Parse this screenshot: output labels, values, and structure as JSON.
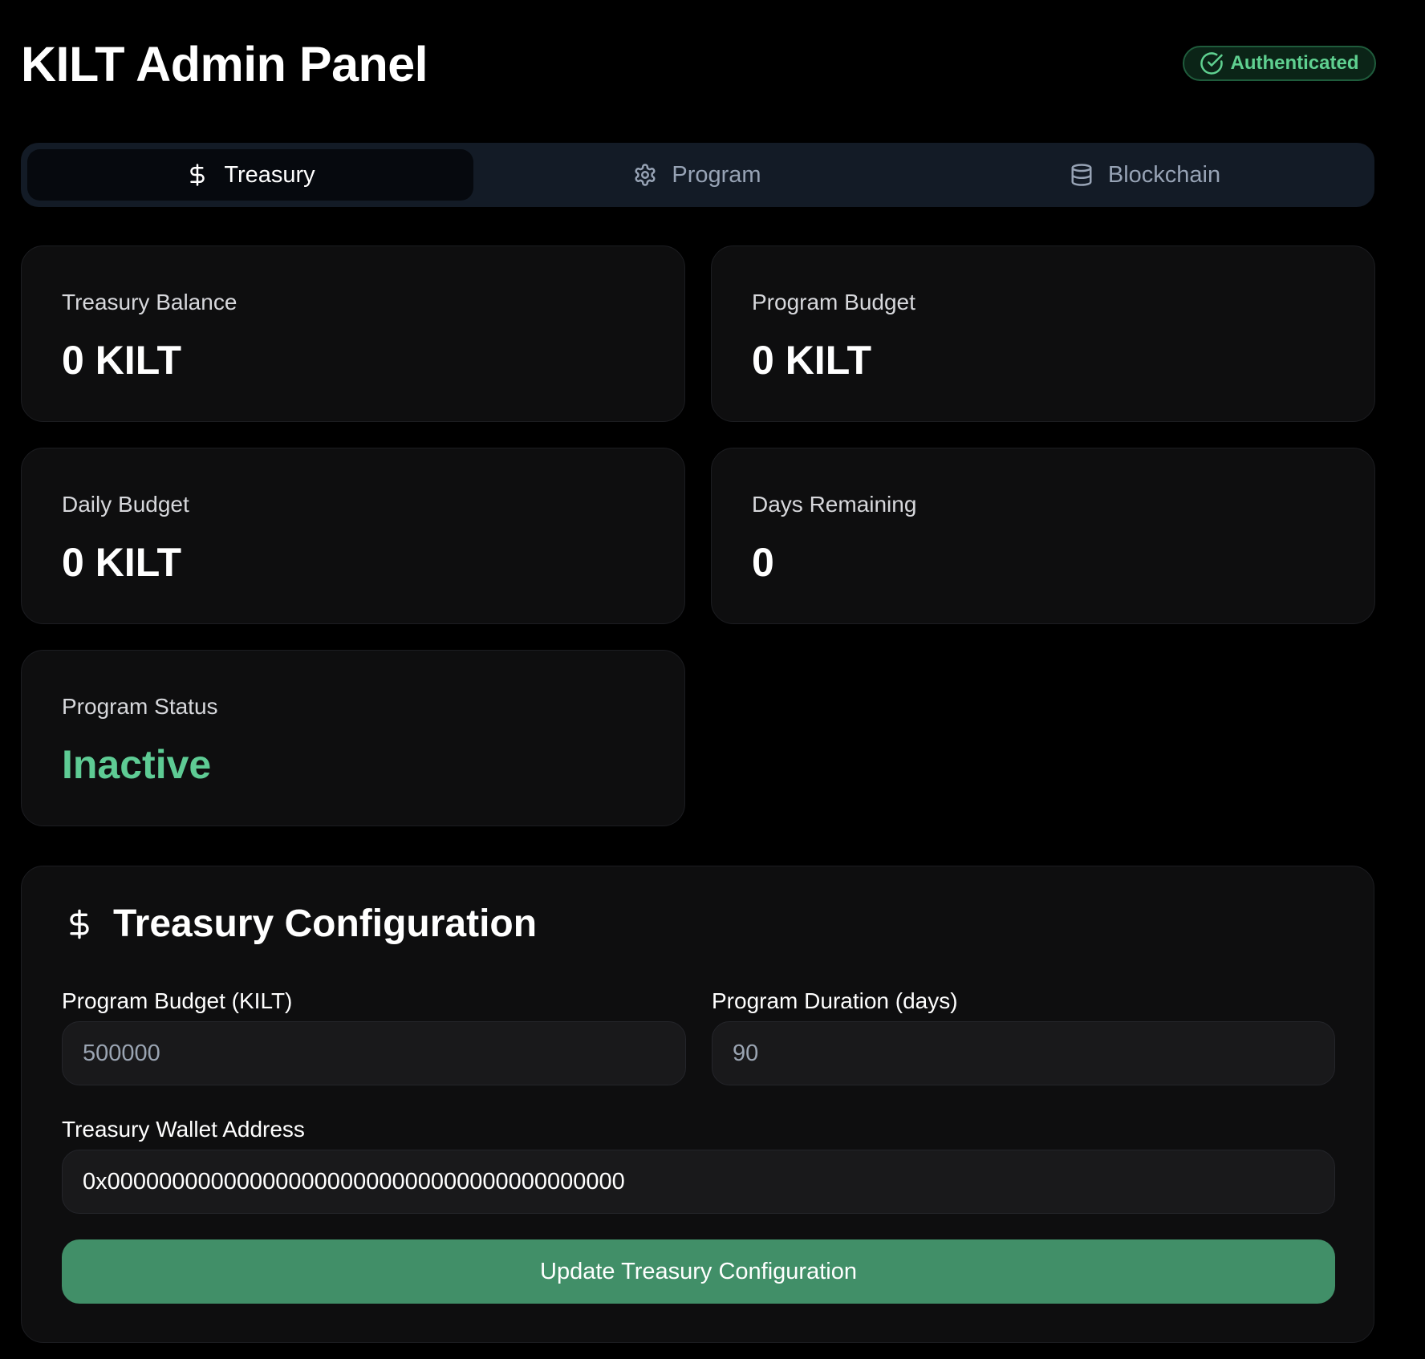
{
  "app": {
    "title": "KILT Admin Panel"
  },
  "auth": {
    "label": "Authenticated",
    "color": "#5fd090"
  },
  "tabs": [
    {
      "label": "Treasury",
      "icon": "dollar-icon",
      "active": true
    },
    {
      "label": "Program",
      "icon": "gear-icon",
      "active": false
    },
    {
      "label": "Blockchain",
      "icon": "database-icon",
      "active": false
    }
  ],
  "stats": {
    "treasury_balance": {
      "label": "Treasury Balance",
      "value": "0 KILT"
    },
    "program_budget": {
      "label": "Program Budget",
      "value": "0 KILT"
    },
    "daily_budget": {
      "label": "Daily Budget",
      "value": "0 KILT"
    },
    "days_remaining": {
      "label": "Days Remaining",
      "value": "0"
    },
    "program_status": {
      "label": "Program Status",
      "value": "Inactive",
      "color": "#5ecb94"
    }
  },
  "config": {
    "title": "Treasury Configuration",
    "budget": {
      "label": "Program Budget (KILT)",
      "placeholder": "500000",
      "value": ""
    },
    "duration": {
      "label": "Program Duration (days)",
      "placeholder": "90",
      "value": ""
    },
    "wallet": {
      "label": "Treasury Wallet Address",
      "value": "0x0000000000000000000000000000000000000000"
    },
    "submit_label": "Update Treasury Configuration",
    "accent": "#418f68"
  }
}
